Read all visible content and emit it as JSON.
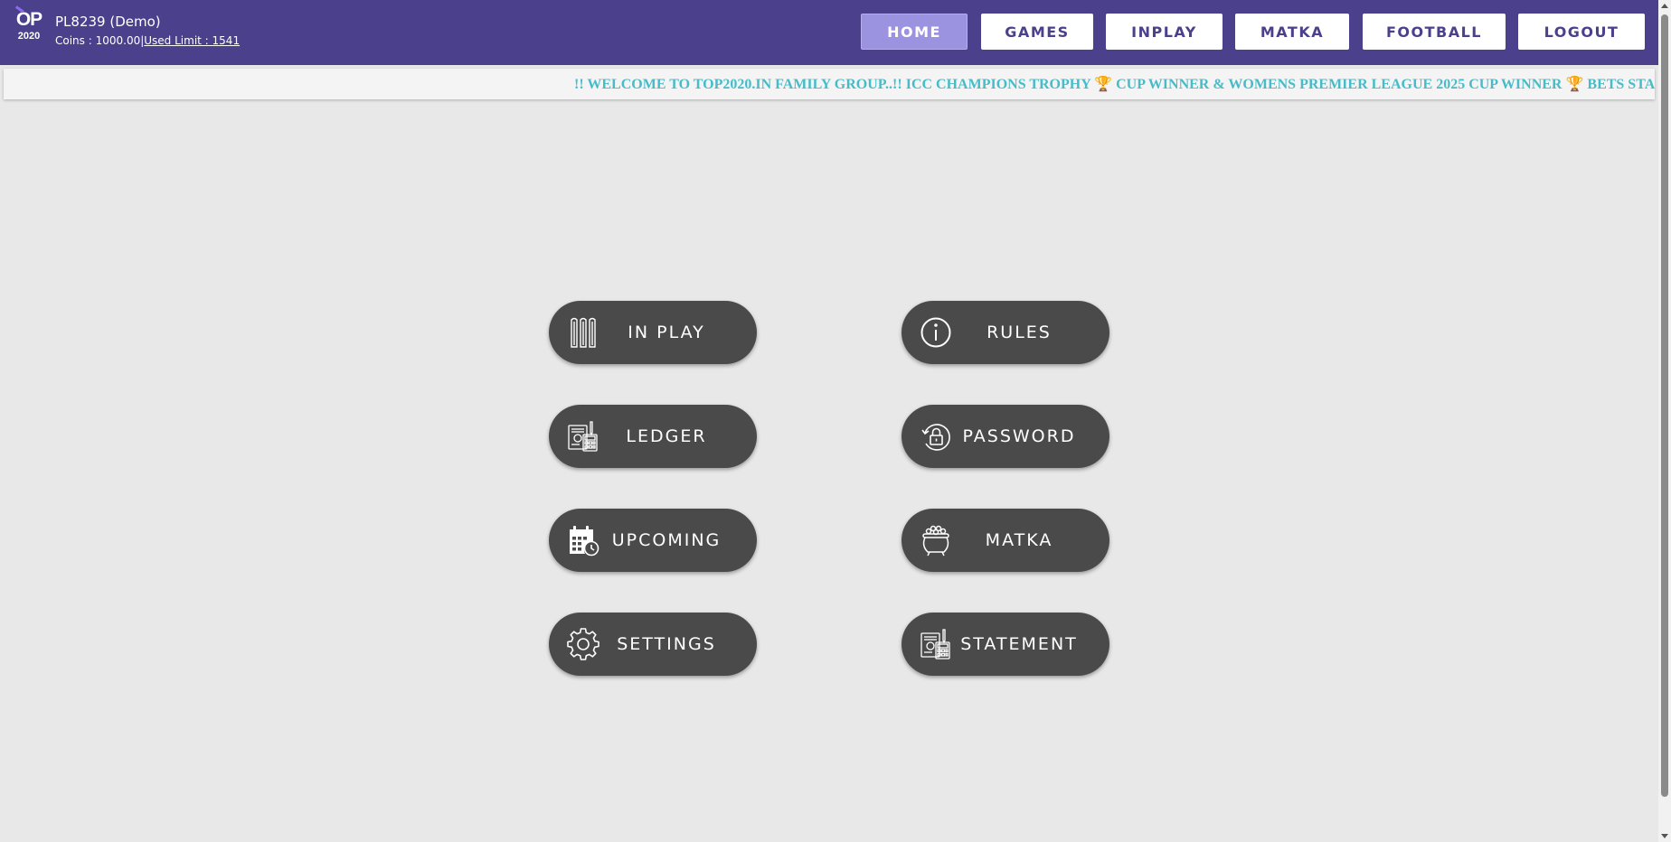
{
  "header": {
    "logo_top": "OP",
    "logo_bottom": "2020",
    "user_name": "PL8239 (Demo)",
    "coins_label": "Coins : 1000.00",
    "separator": "|",
    "used_limit_label": "Used Limit : 1541"
  },
  "nav": {
    "home": "HOME",
    "games": "GAMES",
    "inplay": "INPLAY",
    "matka": "MATKA",
    "football": "FOOTBALL",
    "logout": "LOGOUT",
    "active_color": "#9c93e0",
    "brand_color": "#4a408c"
  },
  "ticker": {
    "message": "!! WELCOME TO TOP2020.IN FAMILY GROUP..!! ICC CHAMPIONS TROPHY 🏆 CUP WINNER & WOMENS PREMIER LEAGUE 2025 CUP WINNER 🏆 BETS STARTED IN OUR EXCHANGE",
    "color": "#46bcc9"
  },
  "menu": {
    "in_play": "IN PLAY",
    "rules": "RULES",
    "ledger": "LEDGER",
    "password": "PASSWORD",
    "upcoming": "UPCOMING",
    "matka": "MATKA",
    "settings": "SETTINGS",
    "statement": "STATEMENT",
    "icons": {
      "in_play": "cricket-stumps-icon",
      "rules": "info-icon",
      "ledger": "ledger-calculator-icon",
      "password": "lock-refresh-icon",
      "upcoming": "calendar-clock-icon",
      "matka": "pot-icon",
      "settings": "gear-icon",
      "statement": "statement-calculator-icon"
    },
    "tile_color": "#4a4a4a"
  }
}
